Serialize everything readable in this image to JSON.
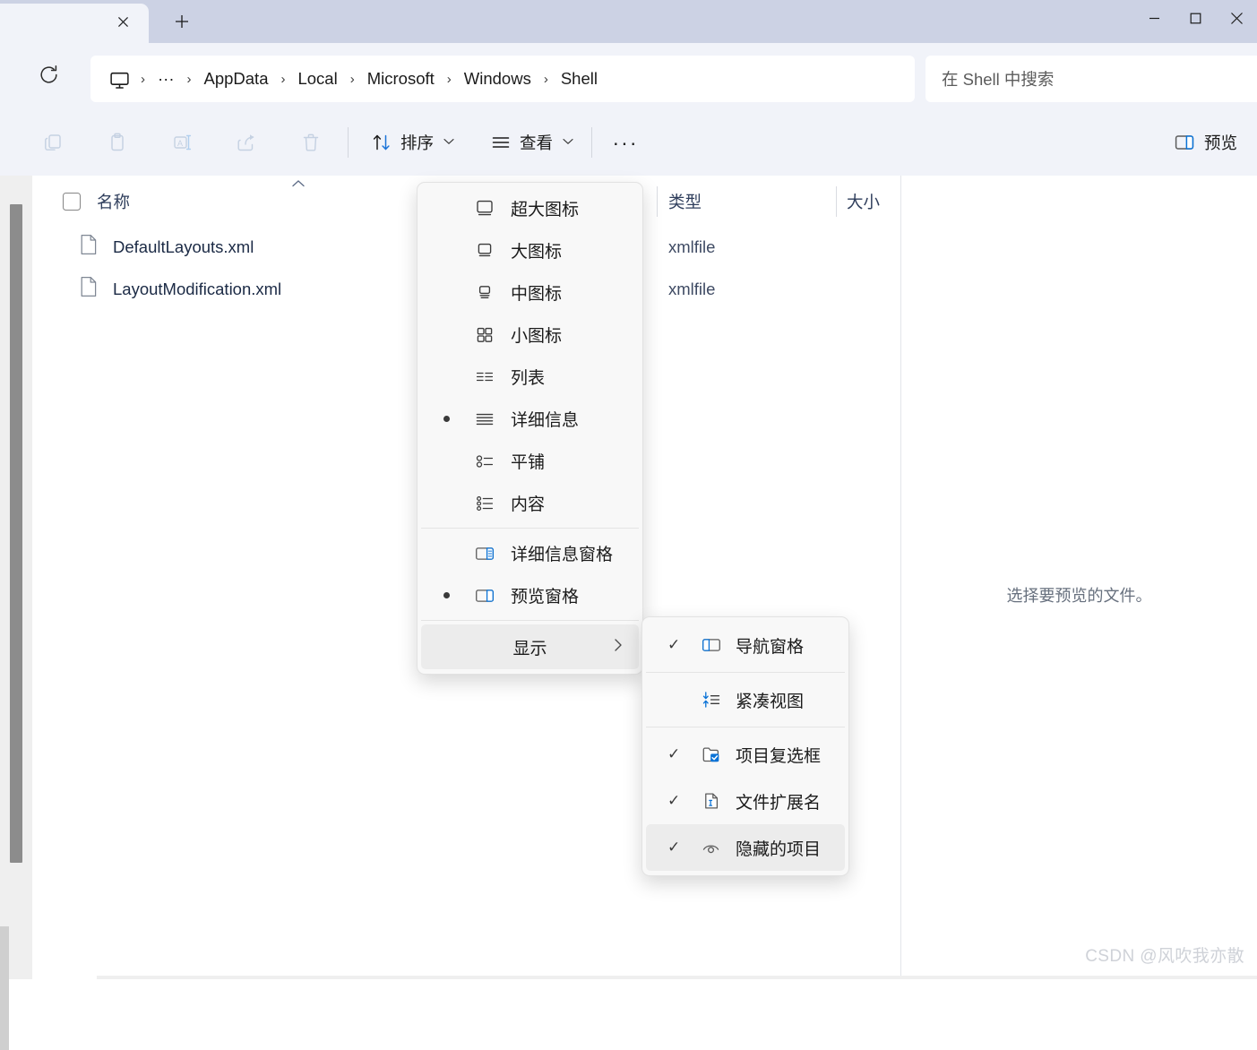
{
  "window": {
    "tab_close_label": "✕",
    "new_tab_label": "+",
    "controls": {
      "minimize": "minimize-icon",
      "maximize": "maximize-icon",
      "close": "close-icon"
    }
  },
  "address": {
    "refresh_label": "refresh-icon",
    "root_icon": "this-pc-icon",
    "overflow": "···",
    "separator": "›",
    "crumbs": [
      "AppData",
      "Local",
      "Microsoft",
      "Windows",
      "Shell"
    ]
  },
  "search": {
    "placeholder": "在 Shell 中搜索",
    "icon": "search-icon"
  },
  "toolbar": {
    "buttons": [
      {
        "name": "copy-button",
        "icon": "copy-icon",
        "disabled": true
      },
      {
        "name": "paste-button",
        "icon": "clipboard-icon",
        "disabled": true
      },
      {
        "name": "rename-button",
        "icon": "rename-icon",
        "disabled": true
      },
      {
        "name": "share-button",
        "icon": "share-icon",
        "disabled": true
      },
      {
        "name": "delete-button",
        "icon": "trash-icon",
        "disabled": true
      }
    ],
    "sort_label": "排序",
    "view_label": "查看",
    "more_label": "···",
    "preview_label": "预览",
    "chevron": "⌵"
  },
  "columns": {
    "name": "名称",
    "type": "类型",
    "size": "大小",
    "sort_caret": "⌃"
  },
  "files": [
    {
      "name": "DefaultLayouts.xml",
      "type": "xmlfile",
      "size": ""
    },
    {
      "name": "LayoutModification.xml",
      "type": "xmlfile",
      "size": ""
    }
  ],
  "preview": {
    "empty_message": "选择要预览的文件。"
  },
  "watermark": "CSDN @风吹我亦散",
  "view_menu": {
    "items": [
      {
        "label": "超大图标",
        "icon": "extra-large-icons-icon",
        "selected": false,
        "bullet": false
      },
      {
        "label": "大图标",
        "icon": "large-icons-icon",
        "selected": false,
        "bullet": false
      },
      {
        "label": "中图标",
        "icon": "medium-icons-icon",
        "selected": false,
        "bullet": false
      },
      {
        "label": "小图标",
        "icon": "small-icons-icon",
        "selected": false,
        "bullet": false
      },
      {
        "label": "列表",
        "icon": "list-view-icon",
        "selected": false,
        "bullet": false
      },
      {
        "label": "详细信息",
        "icon": "details-view-icon",
        "selected": false,
        "bullet": true
      },
      {
        "label": "平铺",
        "icon": "tiles-view-icon",
        "selected": false,
        "bullet": false
      },
      {
        "label": "内容",
        "icon": "content-view-icon",
        "selected": false,
        "bullet": false
      }
    ],
    "panes": [
      {
        "label": "详细信息窗格",
        "icon": "details-pane-icon",
        "bullet": false
      },
      {
        "label": "预览窗格",
        "icon": "preview-pane-icon",
        "bullet": true
      }
    ],
    "show_item": {
      "label": "显示",
      "arrow": "›",
      "selected": true
    }
  },
  "show_submenu": {
    "items": [
      {
        "label": "导航窗格",
        "icon": "navigation-pane-icon",
        "checked": true,
        "highlighted": false
      },
      {
        "label": "紧凑视图",
        "icon": "compact-view-icon",
        "checked": false,
        "highlighted": false
      },
      {
        "label": "项目复选框",
        "icon": "item-checkbox-icon",
        "checked": true,
        "highlighted": false
      },
      {
        "label": "文件扩展名",
        "icon": "file-extension-icon",
        "checked": true,
        "highlighted": false
      },
      {
        "label": "隐藏的项目",
        "icon": "hidden-items-icon",
        "checked": true,
        "highlighted": true
      }
    ],
    "check_glyph": "✓"
  },
  "colors": {
    "tabstrip": "#ccd2e4",
    "chrome": "#f1f3f9",
    "accent": "#0a72d6",
    "menu_bg": "#f8f8f8",
    "menu_sel": "#ececec"
  }
}
